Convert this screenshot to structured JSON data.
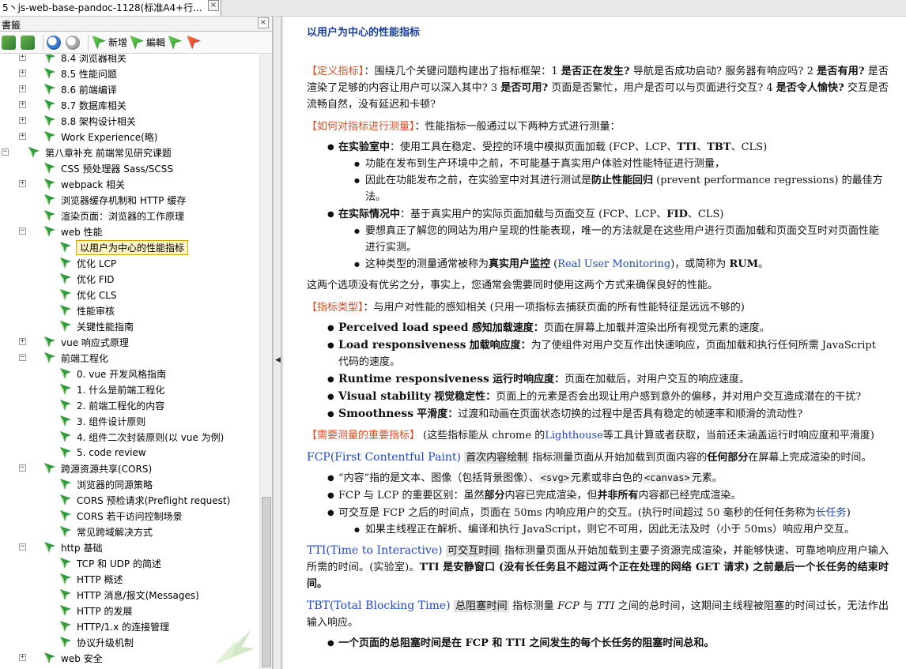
{
  "window": {
    "tab_title": "5丶js-web-base-pandoc-1128(标准A4+行...",
    "tab_close": "×"
  },
  "bookmarks": {
    "title": "書籤",
    "close": "×",
    "toolbar": {
      "new_label": "新增",
      "edit_label": "編輯"
    },
    "items": [
      {
        "label": "8.4 浏览器相关",
        "level": 1,
        "expander": "+"
      },
      {
        "label": "8.5 性能问题",
        "level": 1,
        "expander": "+"
      },
      {
        "label": "8.6 前端编译",
        "level": 1,
        "expander": "+"
      },
      {
        "label": "8.7 数据库相关",
        "level": 1,
        "expander": "+"
      },
      {
        "label": "8.8 架构设计相关",
        "level": 1,
        "expander": "+"
      },
      {
        "label": "Work Experience(略)",
        "level": 1,
        "expander": "+"
      },
      {
        "label": "第八章补充 前端常见研究课题",
        "level": 0,
        "expander": "−"
      },
      {
        "label": "CSS 预处理器 Sass/SCSS",
        "level": 1,
        "expander": ""
      },
      {
        "label": "webpack 相关",
        "level": 1,
        "expander": "+"
      },
      {
        "label": "浏览器缓存机制和 HTTP 缓存",
        "level": 1,
        "expander": ""
      },
      {
        "label": "渲染页面：浏览器的工作原理",
        "level": 1,
        "expander": ""
      },
      {
        "label": "web 性能",
        "level": 1,
        "expander": "−"
      },
      {
        "label": "以用户为中心的性能指标",
        "level": 2,
        "expander": "",
        "selected": true
      },
      {
        "label": "优化 LCP",
        "level": 2,
        "expander": ""
      },
      {
        "label": "优化 FID",
        "level": 2,
        "expander": ""
      },
      {
        "label": "优化 CLS",
        "level": 2,
        "expander": ""
      },
      {
        "label": "性能审核",
        "level": 2,
        "expander": ""
      },
      {
        "label": "关键性能指南",
        "level": 2,
        "expander": ""
      },
      {
        "label": "vue 响应式原理",
        "level": 1,
        "expander": "+"
      },
      {
        "label": "前端工程化",
        "level": 1,
        "expander": "−"
      },
      {
        "label": "0. vue 开发风格指南",
        "level": 2,
        "expander": ""
      },
      {
        "label": "1. 什么是前端工程化",
        "level": 2,
        "expander": ""
      },
      {
        "label": "2. 前端工程化的内容",
        "level": 2,
        "expander": ""
      },
      {
        "label": "3. 组件设计原则",
        "level": 2,
        "expander": ""
      },
      {
        "label": "4. 组件二次封装原则(以 vue 为例)",
        "level": 2,
        "expander": ""
      },
      {
        "label": "5. code review",
        "level": 2,
        "expander": ""
      },
      {
        "label": "跨源资源共享(CORS)",
        "level": 1,
        "expander": "−"
      },
      {
        "label": "浏览器的同源策略",
        "level": 2,
        "expander": ""
      },
      {
        "label": "CORS 预检请求(Preflight request)",
        "level": 2,
        "expander": ""
      },
      {
        "label": "CORS 若干访问控制场景",
        "level": 2,
        "expander": ""
      },
      {
        "label": "常见跨域解决方式",
        "level": 2,
        "expander": ""
      },
      {
        "label": "http 基础",
        "level": 1,
        "expander": "−"
      },
      {
        "label": "TCP 和 UDP 的简述",
        "level": 2,
        "expander": ""
      },
      {
        "label": "HTTP 概述",
        "level": 2,
        "expander": ""
      },
      {
        "label": "HTTP 消息/报文(Messages)",
        "level": 2,
        "expander": ""
      },
      {
        "label": "HTTP 的发展",
        "level": 2,
        "expander": ""
      },
      {
        "label": "HTTP/1.x 的连接管理",
        "level": 2,
        "expander": ""
      },
      {
        "label": "协议升级机制",
        "level": 2,
        "expander": ""
      },
      {
        "label": "web 安全",
        "level": 1,
        "expander": "+"
      }
    ]
  },
  "doc": {
    "title": "以用户为中心的性能指标",
    "def_tag": "【定义指标】",
    "def_text_a": "：围绕几个关键问题构建出了指标框架：1 ",
    "def_q1": "是否正在发生?",
    "def_text_b": " 导航是否成功启动? 服务器有响应吗? 2 ",
    "def_q2": "是否有用?",
    "def_text_c": " 是否渲染了足够的内容让用户可以深入其中? 3 ",
    "def_q3": "是否可用?",
    "def_text_d": " 页面是否繁忙，用户是否可以与页面进行交互? 4 ",
    "def_q4": "是否令人愉快?",
    "def_text_e": " 交互是否流畅自然，没有延迟和卡顿?",
    "how_tag": "【如何对指标进行测量】",
    "how_text": "：性能指标一般通过以下两种方式进行测量：",
    "lab_head": "在实验室中",
    "lab_text_a": "：使用工具在稳定、受控的环境中模拟页面加载 (FCP、LCP、",
    "lab_tti": "TTI",
    "lab_text_b": "、",
    "lab_tbt": "TBT",
    "lab_text_c": "、CLS)",
    "lab_sub1": "功能在发布到生产环境中之前，不可能基于真实用户体验对性能特征进行测量，",
    "lab_sub2_a": "因此在功能发布之前，在实验室中对其进行测试是",
    "lab_sub2_b": "防止性能回归",
    "lab_sub2_c": " (prevent performance regressions) 的最佳方法。",
    "field_head": "在实际情况中",
    "field_text_a": "：基于真实用户的实际页面加载与页面交互 (FCP、LCP、",
    "field_fid": "FID",
    "field_text_b": "、CLS)",
    "field_sub1": "要想真正了解您的网站为用户呈现的性能表现，唯一的方法就是在这些用户进行页面加载和页面交互时对页面性能进行实测。",
    "field_sub2_a": "这种类型的测量通常被称为",
    "field_sub2_b": "真实用户监控",
    "field_sub2_c": " (",
    "field_sub2_link": "Real User Monitoring",
    "field_sub2_d": ")，或简称为 ",
    "field_sub2_rum": "RUM",
    "field_sub2_e": "。",
    "both_text": "这两个选项没有优劣之分，事实上，您通常会需要同时使用这两个方式来确保良好的性能。",
    "type_tag": "【指标类型】",
    "type_text": "：与用户对性能的感知相关 (只用一项指标去捕获页面的所有性能特征是远远不够的)",
    "types": [
      {
        "en": "Perceived load speed",
        "cn": "感知加载速度：",
        "desc": "页面在屏幕上加载并渲染出所有视觉元素的速度。"
      },
      {
        "en": "Load responsiveness",
        "cn": "加载响应度：",
        "desc": "为了使组件对用户交互作出快速响应，页面加载和执行任何所需 JavaScript 代码的速度。"
      },
      {
        "en": "Runtime responsiveness",
        "cn": "运行时响应度：",
        "desc": "页面在加载后，对用户交互的响应速度。"
      },
      {
        "en": "Visual stability",
        "cn": "视觉稳定性：",
        "desc": "页面上的元素是否会出现让用户感到意外的偏移，并对用户交互造成潜在的干扰?"
      },
      {
        "en": "Smoothness",
        "cn": "平滑度：",
        "desc": "过渡和动画在页面状态切换的过程中是否具有稳定的帧速率和顺滑的流动性?"
      }
    ],
    "imp_tag": "【需要测量的重要指标】",
    "imp_text_a": " (这些指标能从 chrome 的",
    "imp_link": "Lighthouse",
    "imp_text_b": "等工具计算或者获取，当前还未涵盖运行时响应度和平滑度)",
    "fcp_link": "FCP(First Contentful Paint)",
    "fcp_hl": "首次内容绘制",
    "fcp_text_a": " 指标测量页面从开始加载到页面内容的",
    "fcp_bold": "任何部分",
    "fcp_text_b": "在屏幕上完成渲染的时间。",
    "fcp_sub1_a": "“内容”指的是文本、图像（包括背景图像）、",
    "fcp_sub1_code1": "<svg>",
    "fcp_sub1_b": "元素或非白色的",
    "fcp_sub1_code2": "<canvas>",
    "fcp_sub1_c": "元素。",
    "fcp_sub2_a": "FCP 与 LCP 的重要区别：虽然",
    "fcp_sub2_b": "部分",
    "fcp_sub2_c": "内容已完成渲染，但",
    "fcp_sub2_d": "并非所有",
    "fcp_sub2_e": "内容都已经完成渲染。",
    "fcp_sub3_a": "可交互是 FCP 之后的时间点，页面在 50ms 内响应用户的交互。(执行时间超过 50 毫秒的任何任务称为",
    "fcp_sub3_link": "长任务",
    "fcp_sub3_b": ")",
    "fcp_sub3_sub": "如果主线程正在解析、编译和执行 JavaScript，则它不可用，因此无法及时（小于 50ms）响应用户交互。",
    "tti_link": "TTI(Time to Interactive)",
    "tti_hl": "可交互时间",
    "tti_text_a": " 指标测量页面从开始加载到主要子资源完成渲染，并能够快速、可靠地响应用户输入所需的时间。(实验室)。",
    "tti_bold": "TTI 是安静窗口 (没有长任务且不超过两个正在处理的网络 GET 请求) 之前最后一个长任务的结束时间。",
    "tbt_link": "TBT(Total Blocking Time)",
    "tbt_hl": "总阻塞时间",
    "tbt_text_a": " 指标测量 ",
    "tbt_it1": "FCP",
    "tbt_text_b": " 与 ",
    "tbt_it2": "TTI",
    "tbt_text_c": " 之间的总时间，这期间主线程被阻塞的时间过长，无法作出输入响应。",
    "tbt_sub1": "一个页面的总阻塞时间是在 FCP 和 TTI 之间发生的每个长任务的阻塞时间总和。"
  }
}
